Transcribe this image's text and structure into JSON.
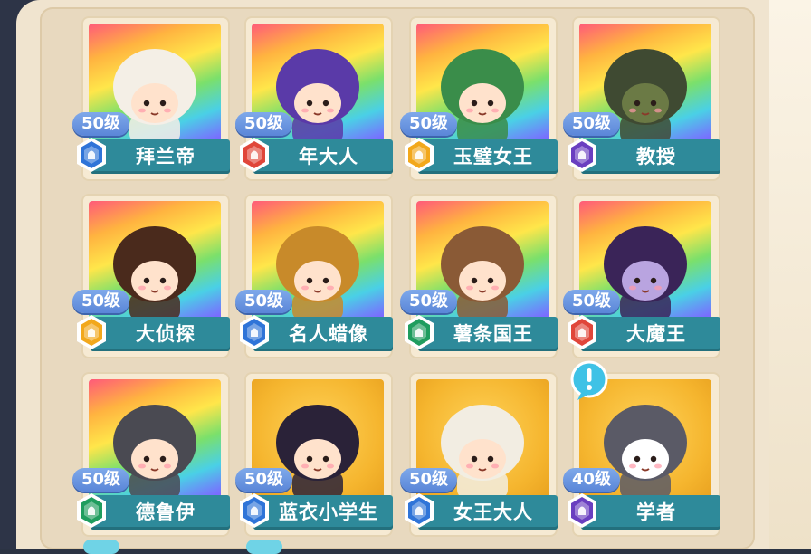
{
  "colors": {
    "nameplate": "#2e8a9a",
    "level_pill": "#6c96e0",
    "panel": "#f0e4cf",
    "badge_blue": "#2f74d8",
    "badge_red": "#e0463a",
    "badge_gold": "#f2a81c",
    "badge_purple": "#6a3fc0",
    "badge_green": "#1f9d5e",
    "alert": "#3fc2e6"
  },
  "characters": [
    {
      "level": "50级",
      "name": "拜兰帝",
      "badge": "blue",
      "bg": "rainbow",
      "hair": "#f4efe6",
      "skin": "#ffe2cc"
    },
    {
      "level": "50级",
      "name": "年大人",
      "badge": "red",
      "bg": "rainbow",
      "hair": "#5a3aa8",
      "skin": "#ffe2cc"
    },
    {
      "level": "50级",
      "name": "玉璧女王",
      "badge": "gold",
      "bg": "rainbow",
      "hair": "#3a8d4a",
      "skin": "#ffe2cc"
    },
    {
      "level": "50级",
      "name": "教授",
      "badge": "purple",
      "bg": "rainbow",
      "hair": "#3f4a32",
      "skin": "#6b7a45"
    },
    {
      "level": "50级",
      "name": "大侦探",
      "badge": "gold",
      "bg": "rainbow",
      "hair": "#4a2a1c",
      "skin": "#ffe2cc"
    },
    {
      "level": "50级",
      "name": "名人蜡像",
      "badge": "blue",
      "bg": "rainbow",
      "hair": "#c88a2a",
      "skin": "#ffe2cc"
    },
    {
      "level": "50级",
      "name": "薯条国王",
      "badge": "green",
      "bg": "rainbow",
      "hair": "#8a5a36",
      "skin": "#ffe2cc"
    },
    {
      "level": "50级",
      "name": "大魔王",
      "badge": "red",
      "bg": "rainbow",
      "hair": "#3a2458",
      "skin": "#b9a4e0"
    },
    {
      "level": "50级",
      "name": "德鲁伊",
      "badge": "green",
      "bg": "rainbow",
      "hair": "#4a4a52",
      "skin": "#ffe2cc"
    },
    {
      "level": "50级",
      "name": "蓝衣小学生",
      "badge": "blue",
      "bg": "gold",
      "hair": "#2a2238",
      "skin": "#ffe2cc"
    },
    {
      "level": "50级",
      "name": "女王大人",
      "badge": "blue",
      "bg": "gold",
      "hair": "#f2ede2",
      "skin": "#ffe2cc"
    },
    {
      "level": "40级",
      "name": "学者",
      "badge": "purple",
      "bg": "gold",
      "hair": "#5a5a66",
      "skin": "#ffffff"
    }
  ],
  "alert_icon": "exclamation-bubble-icon"
}
